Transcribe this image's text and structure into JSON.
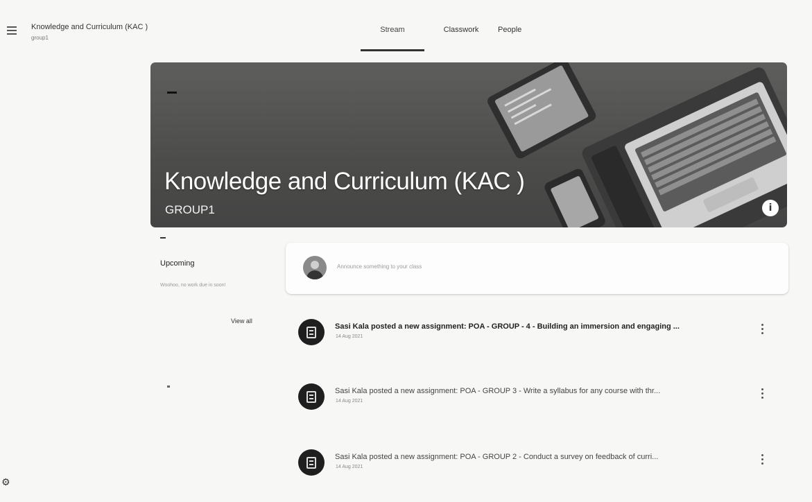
{
  "header": {
    "course_title": "Knowledge and Curriculum (KAC )",
    "course_section": "group1"
  },
  "tabs": [
    {
      "label": "Stream",
      "active": true
    },
    {
      "label": "Classwork",
      "active": false
    },
    {
      "label": "People",
      "active": false
    }
  ],
  "banner": {
    "title": "Knowledge and Curriculum (KAC )",
    "subtitle": "GROUP1",
    "info_glyph": "i",
    "icon": "info-icon"
  },
  "upcoming": {
    "title": "Upcoming",
    "message": "Woohoo, no work due in soon!",
    "view_all_label": "View all"
  },
  "announce": {
    "placeholder": "Announce something to your class"
  },
  "posts": [
    {
      "text": "Sasi Kala posted a new assignment: POA - GROUP - 4 - Building an immersion and engaging ...",
      "date": "14 Aug 2021",
      "icon": "assignment-icon"
    },
    {
      "text": "Sasi Kala posted a new assignment: POA - GROUP 3 - Write a syllabus for any course with thr...",
      "date": "14 Aug 2021",
      "icon": "assignment-icon"
    },
    {
      "text": "Sasi Kala posted a new assignment: POA - GROUP 2 - Conduct a survey on feedback of curri...",
      "date": "14 Aug 2021",
      "icon": "assignment-icon"
    }
  ],
  "colors": {
    "background": "#f7f7f5",
    "banner": "#555555",
    "text": "#222222"
  }
}
